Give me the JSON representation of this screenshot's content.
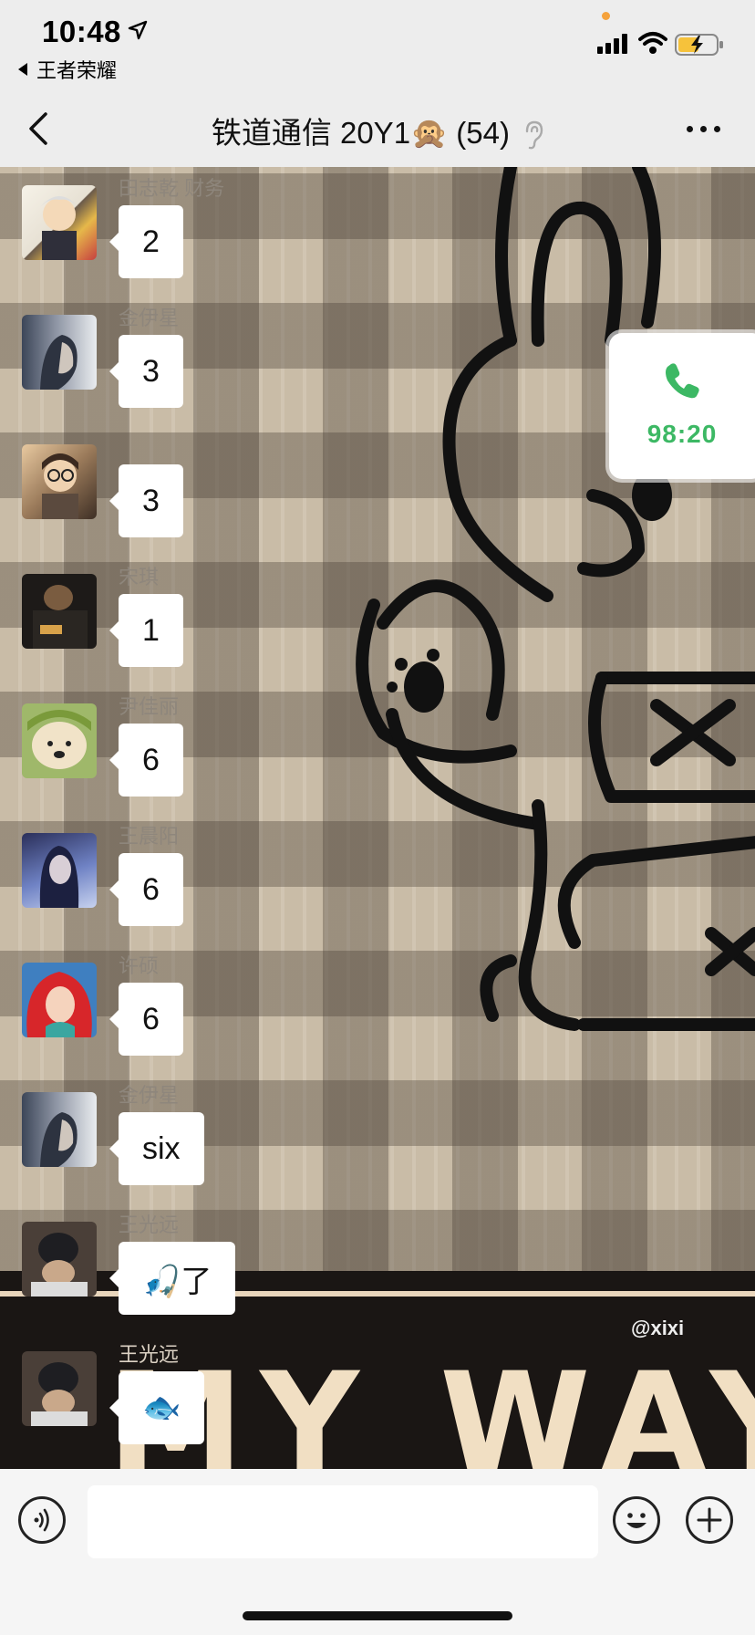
{
  "status_bar": {
    "time": "10:48",
    "back_app": "王者荣耀",
    "icons": [
      "location-arrow-icon",
      "signal-icon",
      "wifi-icon",
      "battery-charging-icon"
    ]
  },
  "nav": {
    "title": "铁道通信 20Y1🙊 (54)",
    "icons": [
      "back-chevron-icon",
      "ear-icon",
      "more-dots-icon"
    ]
  },
  "messages": [
    {
      "sender": "田志乾  财务",
      "text": "2"
    },
    {
      "sender": "金伊星",
      "text": "3"
    },
    {
      "sender": "",
      "text": "3"
    },
    {
      "sender": "宋琪",
      "text": "1"
    },
    {
      "sender": "尹佳丽",
      "text": "6"
    },
    {
      "sender": "王晨阳",
      "text": "6"
    },
    {
      "sender": "许硕",
      "text": "6"
    },
    {
      "sender": "金伊星",
      "text": "six"
    },
    {
      "sender": "王光远",
      "text": "🎣了"
    },
    {
      "sender": "王光远",
      "text": "🐟"
    }
  ],
  "call_widget": {
    "duration": "98:20",
    "icon": "phone-icon",
    "color": "#3cb864"
  },
  "background": {
    "watermark": "@xixi",
    "big_text": "MY WAY"
  },
  "input_bar": {
    "placeholder": "",
    "icons": [
      "voice-icon",
      "emoji-icon",
      "plus-icon"
    ]
  }
}
